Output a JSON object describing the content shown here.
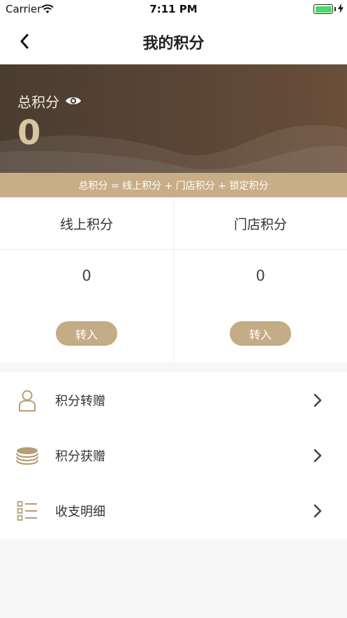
{
  "status_bar": {
    "carrier": "Carrier",
    "time": "7:11 PM"
  },
  "nav": {
    "title": "我的积分"
  },
  "hero": {
    "label": "总积分",
    "value": "0"
  },
  "formula": "总积分 = 线上积分 + 门店积分 + 锁定积分",
  "points": [
    {
      "title": "线上积分",
      "value": "0",
      "button": "转入"
    },
    {
      "title": "门店积分",
      "value": "0",
      "button": "转入"
    }
  ],
  "menu": [
    {
      "label": "积分转赠",
      "icon": "user-icon"
    },
    {
      "label": "积分获赠",
      "icon": "coins-icon"
    },
    {
      "label": "收支明细",
      "icon": "list-icon"
    }
  ],
  "colors": {
    "accent": "#c8ae87",
    "button": "#c4ac86",
    "hero_dark": "#4a3c30",
    "hero_value": "#d8c6a3",
    "icon": "#b79d75"
  }
}
